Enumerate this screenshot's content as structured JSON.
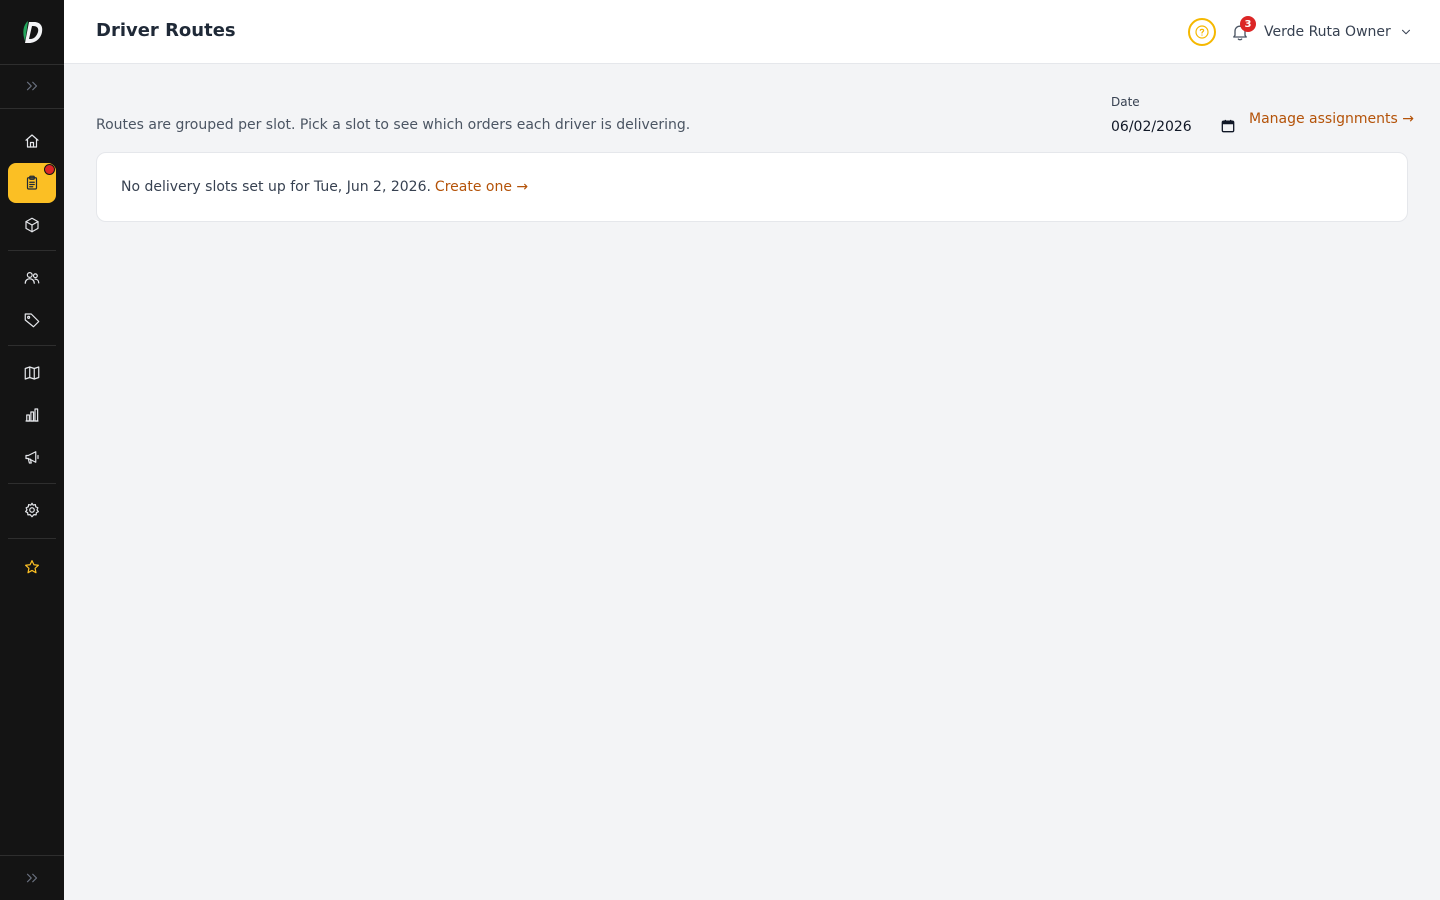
{
  "header": {
    "title": "Driver Routes",
    "notification_count": "3",
    "user_name": "Verde Ruta Owner"
  },
  "main": {
    "subtitle": "Routes are grouped per slot. Pick a slot to see which orders each driver is delivering.",
    "date_label": "Date",
    "date_value": "06/02/2026",
    "manage_link": "Manage assignments →",
    "empty_message": "No delivery slots set up for Tue, Jun 2, 2026.",
    "create_link": "Create one →"
  },
  "sidebar": {
    "items": [
      {
        "icon": "home-icon"
      },
      {
        "icon": "clipboard-icon",
        "active": true,
        "has_alert": true
      },
      {
        "icon": "box-icon"
      },
      {
        "icon": "users-icon"
      },
      {
        "icon": "tag-icon"
      },
      {
        "icon": "map-icon"
      },
      {
        "icon": "bar-chart-icon"
      },
      {
        "icon": "megaphone-icon"
      },
      {
        "icon": "gear-icon"
      },
      {
        "icon": "star-icon"
      }
    ]
  },
  "colors": {
    "accent": "#fbbf24",
    "link": "#b45309",
    "sidebar_bg": "#141414",
    "alert": "#dc2626"
  }
}
